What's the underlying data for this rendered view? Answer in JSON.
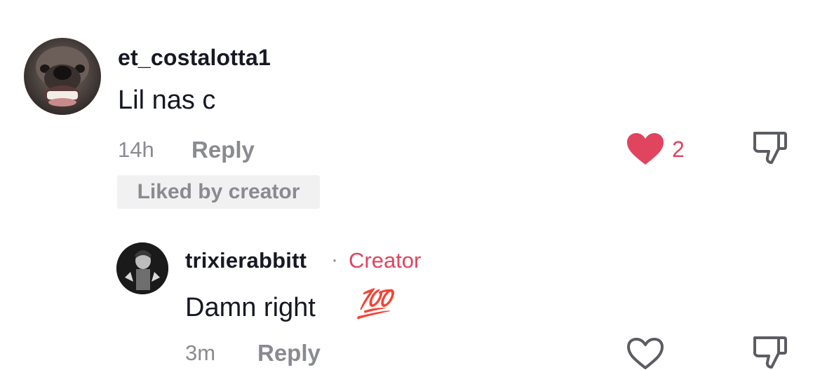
{
  "comments": [
    {
      "username": "et_costalotta1",
      "text": "Lil nas c",
      "time": "14h",
      "reply_label": "Reply",
      "like_count": "2",
      "liked": true,
      "badge": "Liked by creator",
      "avatar_icon": "dog-avatar"
    }
  ],
  "reply": {
    "username": "trixierabbitt",
    "separator": "·",
    "tag": "Creator",
    "text": "Damn right",
    "emoji": "💯",
    "time": "3m",
    "reply_label": "Reply",
    "liked": false,
    "avatar_icon": "character-avatar"
  },
  "colors": {
    "accent": "#e0445f",
    "muted": "#8a8b91",
    "text": "#161823",
    "badge_bg": "#f1f1f2"
  },
  "icons": [
    "heart-filled-icon",
    "heart-outline-icon",
    "thumbs-down-icon"
  ]
}
